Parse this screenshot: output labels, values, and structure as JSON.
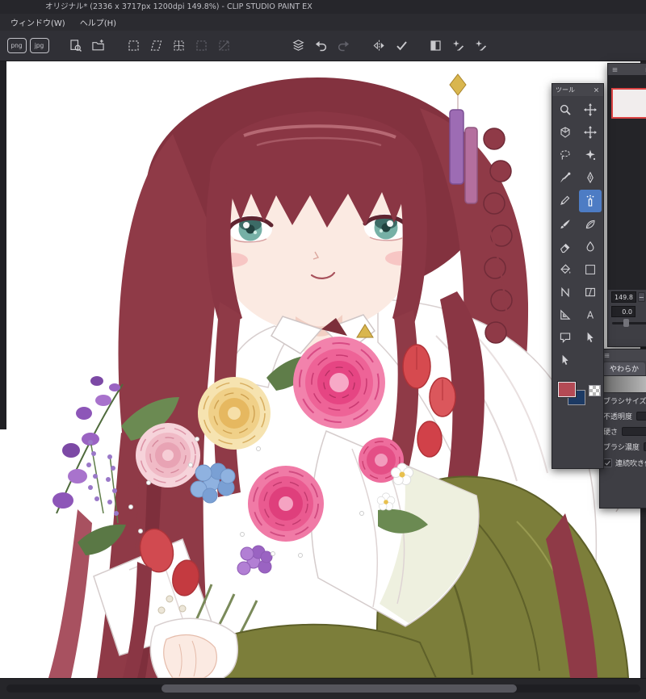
{
  "window": {
    "title": "オリジナル* (2336 x 3717px 1200dpi 149.8%)  - CLIP STUDIO PAINT EX"
  },
  "menu_bar": {
    "items": [
      {
        "label": "ウィンドウ(W)"
      },
      {
        "label": "ヘルプ(H)"
      }
    ]
  },
  "toolbar": {
    "buttons": [
      {
        "id": "export-png",
        "icon": "png-file-icon",
        "label": "png"
      },
      {
        "id": "export-jpg",
        "icon": "jpg-file-icon",
        "label": "jpg"
      },
      {
        "id": "new-window",
        "icon": "document-magnifier-icon"
      },
      {
        "id": "open-file",
        "icon": "folder-plus-icon"
      },
      {
        "id": "transform-scale-rotate",
        "icon": "dashed-box-icon"
      },
      {
        "id": "transform-free",
        "icon": "dashed-skew-icon"
      },
      {
        "id": "transform-mesh",
        "icon": "dashed-mesh-icon"
      },
      {
        "id": "transform-distort",
        "icon": "dashed-box-icon",
        "disabled": true
      },
      {
        "id": "transform-perspective",
        "icon": "dashed-diagonal-icon",
        "disabled": true
      },
      {
        "id": "material",
        "icon": "layer-stack-icon"
      },
      {
        "id": "undo",
        "icon": "undo-arrow-icon"
      },
      {
        "id": "redo",
        "icon": "redo-arrow-icon",
        "disabled": true
      },
      {
        "id": "flip-view",
        "icon": "flip-horizontal-icon"
      },
      {
        "id": "confirm",
        "icon": "check-icon"
      },
      {
        "id": "tone-correction",
        "icon": "half-filled-square-icon"
      },
      {
        "id": "filter-sparkle-1",
        "icon": "sparkle-pen-icon"
      },
      {
        "id": "filter-sparkle-2",
        "icon": "sparkle-pen-icon"
      }
    ]
  },
  "tool_palette": {
    "title": "ツール",
    "tools": [
      {
        "id": "zoom",
        "icon": "magnifier-icon"
      },
      {
        "id": "move",
        "icon": "move-arrows-icon"
      },
      {
        "id": "object",
        "icon": "cube-icon"
      },
      {
        "id": "layer-move",
        "icon": "crosshair-arrows-icon"
      },
      {
        "id": "selection",
        "icon": "lasso-icon"
      },
      {
        "id": "auto-select",
        "icon": "star-wand-icon"
      },
      {
        "id": "eyedropper",
        "icon": "eyedropper-icon"
      },
      {
        "id": "pen",
        "icon": "pen-nib-icon"
      },
      {
        "id": "pencil",
        "icon": "pencil-icon"
      },
      {
        "id": "airbrush",
        "icon": "airbrush-icon",
        "selected": true
      },
      {
        "id": "brush",
        "icon": "brush-icon"
      },
      {
        "id": "decoration",
        "icon": "leaf-icon"
      },
      {
        "id": "eraser",
        "icon": "eraser-icon"
      },
      {
        "id": "blend",
        "icon": "water-drop-icon"
      },
      {
        "id": "fill",
        "icon": "paint-bucket-icon"
      },
      {
        "id": "gradient",
        "icon": "gradient-square-icon"
      },
      {
        "id": "figure",
        "icon": "curve-icon"
      },
      {
        "id": "frame-border",
        "icon": "frame-icon"
      },
      {
        "id": "ruler",
        "icon": "triangle-ruler-icon"
      },
      {
        "id": "text",
        "icon": "text-a-icon"
      },
      {
        "id": "balloon",
        "icon": "speech-balloon-icon"
      },
      {
        "id": "line-correct",
        "icon": "cursor-arrow-icon"
      },
      {
        "id": "operation",
        "icon": "cursor-arrow-icon"
      }
    ],
    "colors": {
      "foreground": "#b34a55",
      "background": "#1c3a64"
    }
  },
  "navigator": {
    "zoom_value": "149.8",
    "rotation_value": "0.0",
    "zoom_out_label": "−",
    "zoom_in_label": "+"
  },
  "tool_property": {
    "subtool_tab": "やわらか",
    "sliders": [
      {
        "label": "ブラシサイズ"
      },
      {
        "label": "不透明度"
      },
      {
        "label": "硬さ"
      },
      {
        "label": "ブラシ濃度"
      }
    ],
    "checkbox": {
      "label": "連続吹き付け",
      "checked": true
    }
  }
}
